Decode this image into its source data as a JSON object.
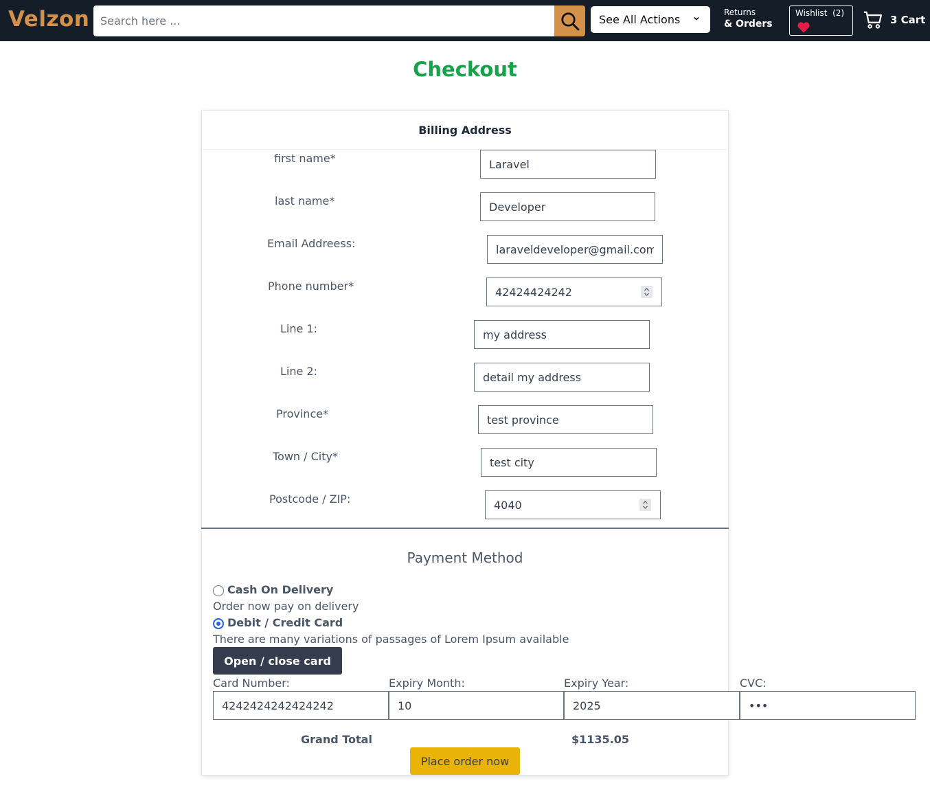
{
  "header": {
    "logo": "Velzon",
    "search": {
      "placeholder": "Search here ...",
      "value": ""
    },
    "actions_select": {
      "selected": "See All Actions"
    },
    "returns": {
      "line1": "Returns",
      "line2": "& Orders"
    },
    "wishlist": {
      "label": "Wishlist",
      "count": "(2)"
    },
    "cart": {
      "label": "3 Cart"
    }
  },
  "page": {
    "title": "Checkout"
  },
  "billing": {
    "title": "Billing Address",
    "fields": {
      "first_name": {
        "label": "first name*",
        "value": "Laravel"
      },
      "last_name": {
        "label": "last name*",
        "value": "Developer"
      },
      "email": {
        "label": "Email Addreess:",
        "value": "laraveldeveloper@gmail.com"
      },
      "phone": {
        "label": "Phone number*",
        "value": "42424424242"
      },
      "line1": {
        "label": "Line 1:",
        "value": "my address"
      },
      "line2": {
        "label": "Line 2:",
        "value": "detail my address"
      },
      "province": {
        "label": "Province*",
        "value": "test province"
      },
      "city": {
        "label": "Town / City*",
        "value": "test city"
      },
      "postcode": {
        "label": "Postcode / ZIP:",
        "value": "4040"
      }
    }
  },
  "payment": {
    "title": "Payment Method",
    "options": [
      {
        "label": "Cash On Delivery",
        "description": "Order now pay on delivery",
        "selected": false
      },
      {
        "label": "Debit / Credit Card",
        "description": "There are many variations of passages of Lorem Ipsum available",
        "selected": true
      }
    ],
    "toggle_button": "Open / close card",
    "card": {
      "number": {
        "label": "Card Number:",
        "value": "4242424242424242"
      },
      "month": {
        "label": "Expiry Month:",
        "value": "10"
      },
      "year": {
        "label": "Expiry Year:",
        "value": "2025"
      },
      "cvc": {
        "label": "CVC:",
        "value": "•••"
      }
    }
  },
  "summary": {
    "total_label": "Grand Total",
    "total_value": "$1135.05",
    "place_order": "Place order now"
  },
  "colors": {
    "navbar": "#151d28",
    "brand": "#d4914a",
    "title_green": "#16a34a",
    "place_order": "#eab308",
    "toggle_button": "#353c4e"
  }
}
